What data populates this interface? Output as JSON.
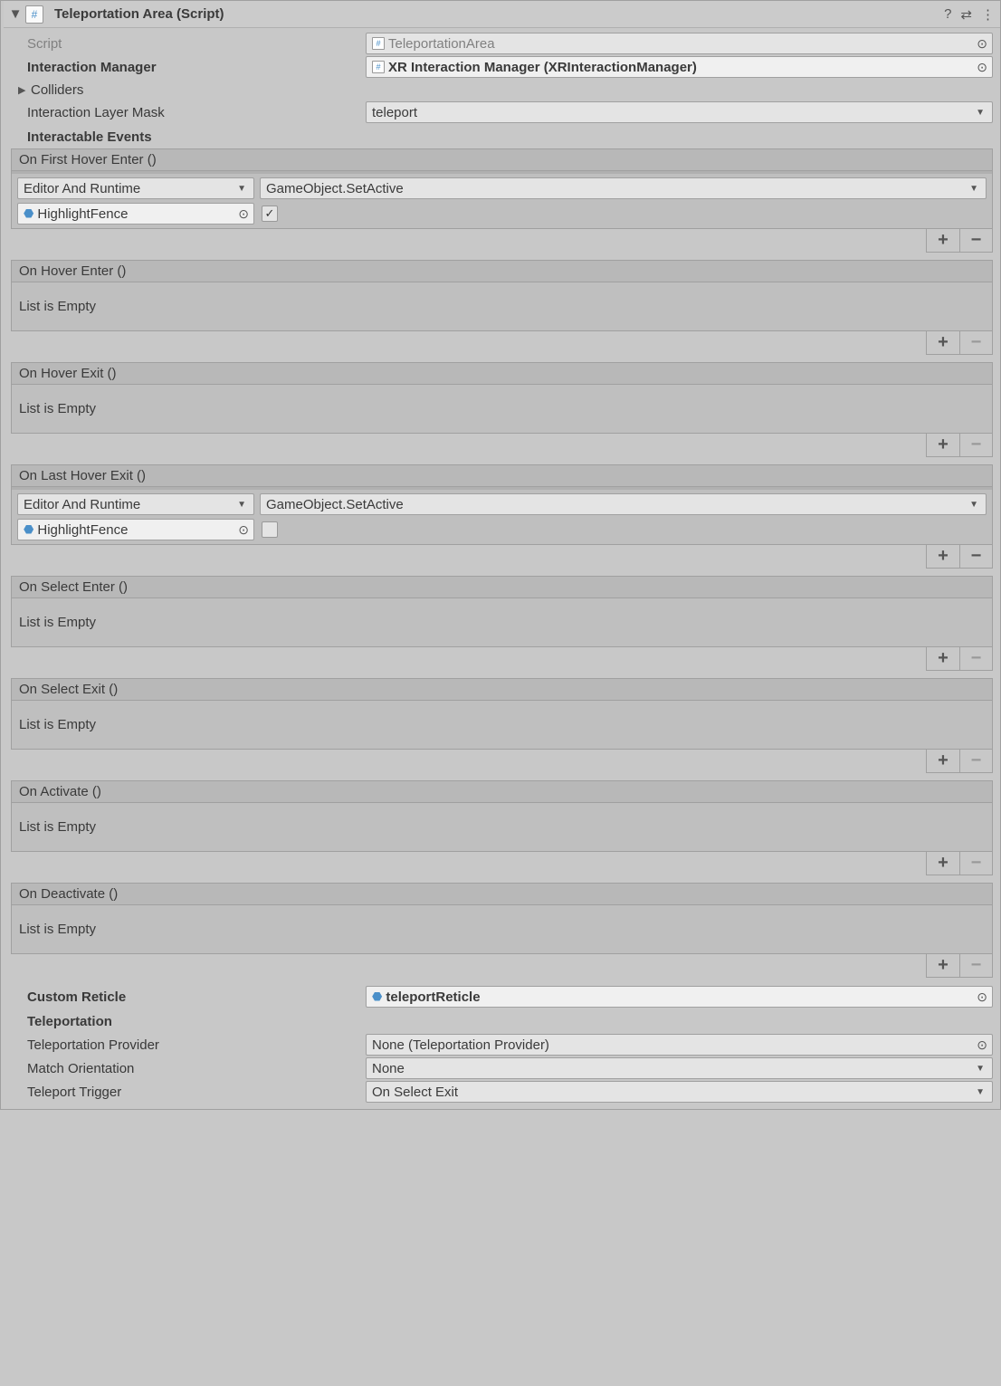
{
  "component": {
    "title": "Teleportation Area (Script)"
  },
  "fields": {
    "scriptLabel": "Script",
    "scriptValue": "TeleportationArea",
    "interactionManagerLabel": "Interaction Manager",
    "interactionManagerValue": "XR Interaction Manager (XRInteractionManager)",
    "collidersLabel": "Colliders",
    "layerMaskLabel": "Interaction Layer Mask",
    "layerMaskValue": "teleport",
    "eventsTitle": "Interactable Events",
    "customReticleLabel": "Custom Reticle",
    "customReticleValue": "teleportReticle",
    "teleportationTitle": "Teleportation",
    "tpProviderLabel": "Teleportation Provider",
    "tpProviderValue": "None (Teleportation Provider)",
    "matchOrientLabel": "Match Orientation",
    "matchOrientValue": "None",
    "tpTriggerLabel": "Teleport Trigger",
    "tpTriggerValue": "On Select Exit"
  },
  "common": {
    "emptyList": "List is Empty",
    "callMode": "Editor And Runtime",
    "funcSetActive": "GameObject.SetActive",
    "highlightObj": "HighlightFence"
  },
  "events": [
    {
      "title": "On First Hover Enter ()",
      "empty": false,
      "checkbox": true
    },
    {
      "title": "On Hover Enter ()",
      "empty": true
    },
    {
      "title": "On Hover Exit ()",
      "empty": true
    },
    {
      "title": "On Last Hover Exit ()",
      "empty": false,
      "checkbox": false
    },
    {
      "title": "On Select Enter ()",
      "empty": true
    },
    {
      "title": "On Select Exit ()",
      "empty": true
    },
    {
      "title": "On Activate ()",
      "empty": true
    },
    {
      "title": "On Deactivate ()",
      "empty": true
    }
  ]
}
